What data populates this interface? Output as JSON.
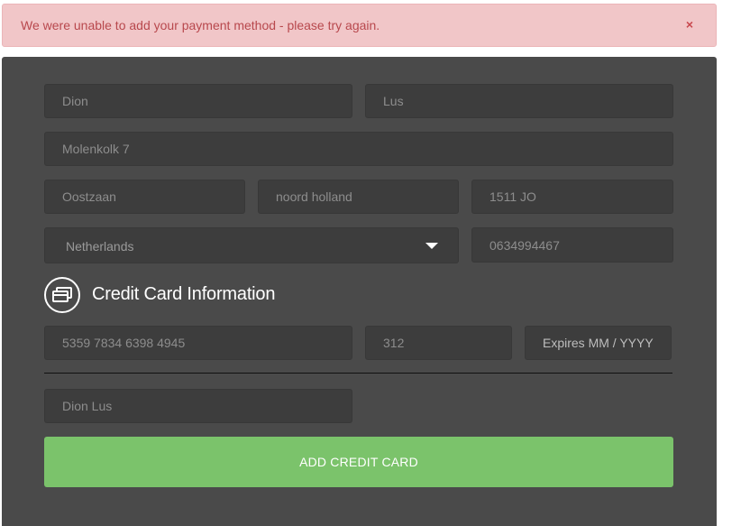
{
  "alert": {
    "message": "We were unable to add your payment method - please try again.",
    "close_label": "×"
  },
  "form": {
    "first_name": "Dion",
    "last_name": "Lus",
    "address": "Molenkolk 7",
    "city": "Oostzaan",
    "state": "noord holland",
    "postal_code": "1511 JO",
    "country": "Netherlands",
    "phone": "0634994467"
  },
  "card_section": {
    "title": "Credit Card Information",
    "icon": "credit-card-icon",
    "card_number": "5359 7834 6398 4945",
    "cvc": "312",
    "expires_placeholder": "Expires MM / YYYY",
    "cardholder_name": "Dion Lus"
  },
  "submit": {
    "label": "ADD CREDIT CARD"
  },
  "colors": {
    "alert_bg": "#f1c6c8",
    "alert_text": "#b8484d",
    "panel_bg": "#4a4a4a",
    "field_bg": "#3d3d3d",
    "accent": "#7bc36b"
  }
}
